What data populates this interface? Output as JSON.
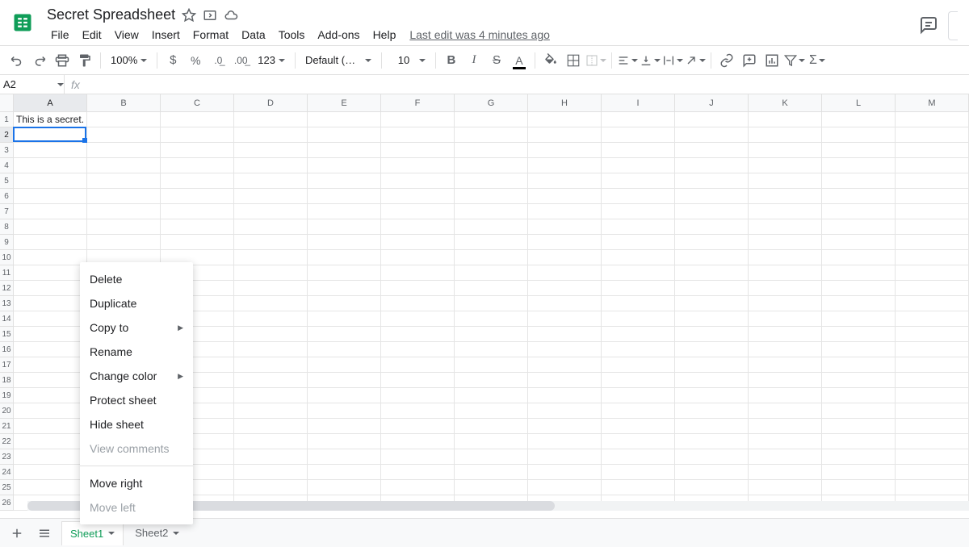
{
  "doc": {
    "title": "Secret Spreadsheet",
    "last_edit": "Last edit was 4 minutes ago"
  },
  "menu": [
    "File",
    "Edit",
    "View",
    "Insert",
    "Format",
    "Data",
    "Tools",
    "Add-ons",
    "Help"
  ],
  "toolbar": {
    "zoom": "100%",
    "number_format": "123",
    "font": "Default (Ari...",
    "font_size": "10"
  },
  "name_box": "A2",
  "formula": "",
  "columns": [
    "A",
    "B",
    "C",
    "D",
    "E",
    "F",
    "G",
    "H",
    "I",
    "J",
    "K",
    "L",
    "M"
  ],
  "rows": [
    1,
    2,
    3,
    4,
    5,
    6,
    7,
    8,
    9,
    10,
    11,
    12,
    13,
    14,
    15,
    16,
    17,
    18,
    19,
    20,
    21,
    22,
    23,
    24,
    25,
    26
  ],
  "cells": {
    "A1": "This is a secret."
  },
  "active_cell": {
    "col": 0,
    "row": 1
  },
  "sheets": [
    {
      "name": "Sheet1",
      "active": true
    },
    {
      "name": "Sheet2",
      "active": false
    }
  ],
  "context_menu": {
    "items": [
      {
        "label": "Delete",
        "submenu": false,
        "disabled": false
      },
      {
        "label": "Duplicate",
        "submenu": false,
        "disabled": false
      },
      {
        "label": "Copy to",
        "submenu": true,
        "disabled": false
      },
      {
        "label": "Rename",
        "submenu": false,
        "disabled": false
      },
      {
        "label": "Change color",
        "submenu": true,
        "disabled": false
      },
      {
        "label": "Protect sheet",
        "submenu": false,
        "disabled": false
      },
      {
        "label": "Hide sheet",
        "submenu": false,
        "disabled": false
      },
      {
        "label": "View comments",
        "submenu": false,
        "disabled": true
      },
      {
        "separator": true
      },
      {
        "label": "Move right",
        "submenu": false,
        "disabled": false
      },
      {
        "label": "Move left",
        "submenu": false,
        "disabled": true
      }
    ]
  }
}
